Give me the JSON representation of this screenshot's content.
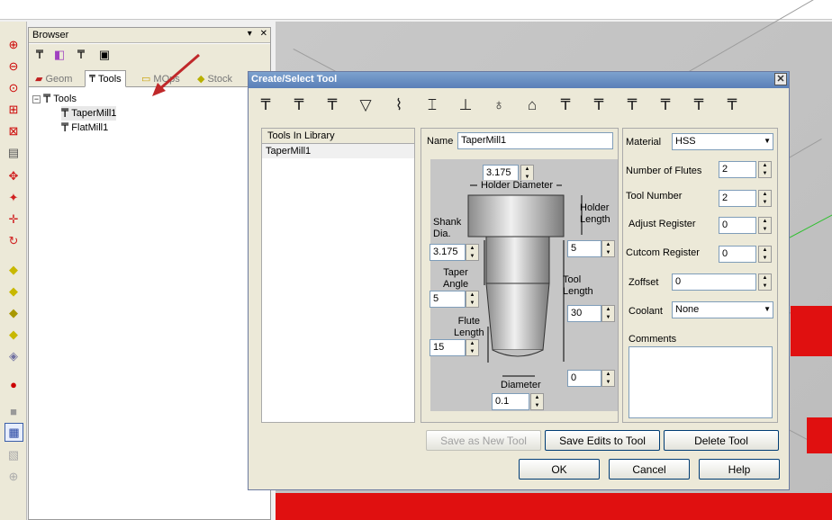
{
  "browser": {
    "title": "Browser",
    "pin": "▾",
    "close": "✕",
    "tabs": [
      {
        "label": "Geom"
      },
      {
        "label": "Tools"
      },
      {
        "label": "MOps"
      },
      {
        "label": "Stock"
      }
    ],
    "tree": {
      "root": "Tools",
      "items": [
        "TaperMill1",
        "FlatMill1"
      ]
    }
  },
  "dialog": {
    "title": "Create/Select Tool",
    "close_glyph": "✕",
    "library": {
      "header": "Tools In Library",
      "items": [
        "TaperMill1"
      ]
    },
    "name": {
      "label": "Name",
      "value": "TaperMill1"
    },
    "diagram": {
      "holder_diameter": {
        "label": "Holder Diameter",
        "value": "3.175"
      },
      "holder_length": {
        "label": "Holder\nLength",
        "value": "5"
      },
      "shank_dia": {
        "label": "Shank\nDia.",
        "value": "3.175"
      },
      "taper_angle": {
        "label": "Taper\nAngle",
        "value": "5"
      },
      "tool_length": {
        "label": "Tool\nLength",
        "value": "30"
      },
      "flute_length": {
        "label": "Flute\nLength",
        "value": "15"
      },
      "corner": {
        "value": "0"
      },
      "diameter": {
        "label": "Diameter",
        "value": "0.1"
      }
    },
    "props": {
      "material": {
        "label": "Material",
        "value": "HSS"
      },
      "flutes": {
        "label": "Number of Flutes",
        "value": "2"
      },
      "tool_number": {
        "label": "Tool Number",
        "value": "2"
      },
      "adjust_register": {
        "label": "Adjust Register",
        "value": "0"
      },
      "cutcom_register": {
        "label": "Cutcom Register",
        "value": "0"
      },
      "zoffset": {
        "label": "Zoffset",
        "value": "0"
      },
      "coolant": {
        "label": "Coolant",
        "value": "None"
      },
      "comments": {
        "label": "Comments",
        "value": ""
      }
    },
    "buttons": {
      "save_new": "Save as New Tool",
      "save_edits": "Save Edits to Tool",
      "delete": "Delete Tool",
      "ok": "OK",
      "cancel": "Cancel",
      "help": "Help"
    }
  },
  "icons": {
    "spin_up": "▲",
    "spin_down": "▼",
    "dropdown": "▼",
    "collapse": "−",
    "tool_glyph": "₸"
  },
  "colors": {
    "title_bar": "#5a7fb8",
    "stock_red": "#e01010",
    "arrow": "#c0282a"
  }
}
